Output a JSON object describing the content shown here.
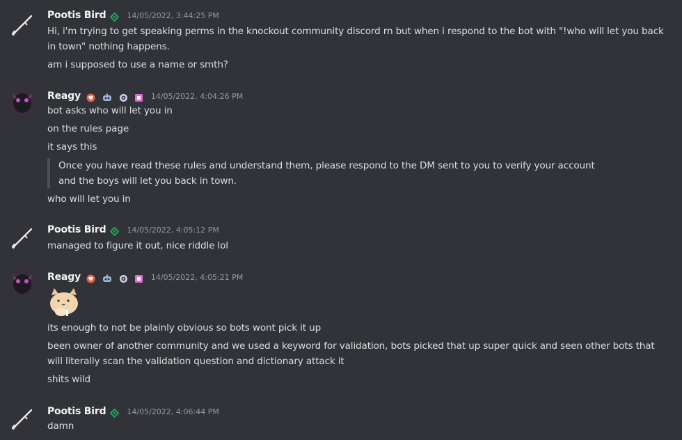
{
  "messages": [
    {
      "author": "Pootis Bird",
      "timestamp": "14/05/2022, 3:44:25 PM",
      "lines": [
        "Hi, i'm trying to get speaking perms in the knockout community discord rn but when i respond to the bot with \"!who will let you back",
        "in town\" nothing happens.",
        "am i supposed to use a name or smth?"
      ]
    },
    {
      "author": "Reagy",
      "timestamp": "14/05/2022, 4:04:26 PM",
      "lines": [
        "bot asks who will let you in",
        "on the rules page",
        "it says this"
      ],
      "quote": [
        "Once you have read these rules and understand them, please respond to the DM sent to you to verify your account",
        "and the boys will let you back in town."
      ],
      "after_quote": "who will let you in"
    },
    {
      "author": "Pootis Bird",
      "timestamp": "14/05/2022, 4:05:12 PM",
      "lines": [
        "managed to figure it out, nice riddle lol"
      ]
    },
    {
      "author": "Reagy",
      "timestamp": "14/05/2022, 4:05:21 PM",
      "lines": [
        "its enough to not be plainly obvious so bots wont pick it up",
        "been owner of another community and we used a keyword for validation, bots picked that up super quick and seen other bots that",
        "will literally scan the validation question and dictionary attack it",
        "shits wild"
      ]
    },
    {
      "author": "Pootis Bird",
      "timestamp": "14/05/2022, 4:06:44 PM",
      "lines": [
        "damn"
      ]
    }
  ],
  "colors": {
    "background": "#313338",
    "username": "#f2f3f5",
    "text": "#dbdee1",
    "timestamp": "#949ba4",
    "verified_badge": "#23a55a",
    "red_badge": "#e8624a",
    "pink_badge": "#e36ad8"
  },
  "icons": {
    "pootis_avatar": "rifle-icon",
    "pootis_badge": "verified-diamond-icon",
    "reagy_avatar": "user-avatar",
    "reagy_badges": [
      "heart-badge-icon",
      "robot-badge-icon",
      "eye-badge-icon",
      "square-badge-icon"
    ],
    "sticker": "cat-sticker"
  }
}
